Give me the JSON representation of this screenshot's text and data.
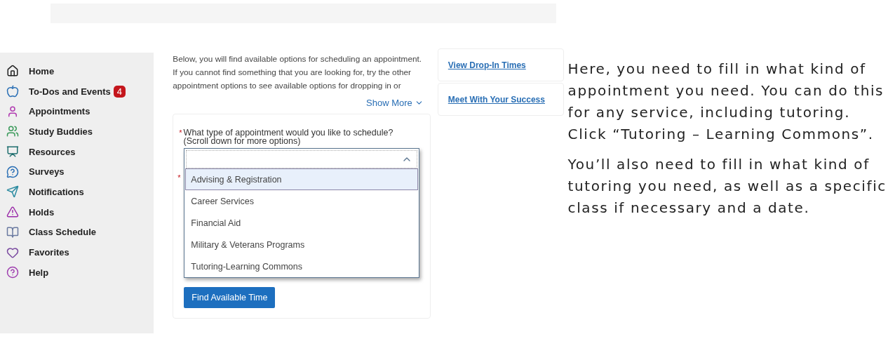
{
  "sidebar": {
    "items": [
      {
        "label": "Home",
        "color": "#222222"
      },
      {
        "label": "To-Dos and Events",
        "color": "#2a6fb5",
        "badge": "4"
      },
      {
        "label": "Appointments",
        "color": "#b03ab0"
      },
      {
        "label": "Study Buddies",
        "color": "#3a9a5a"
      },
      {
        "label": "Resources",
        "color": "#1e6e6e"
      },
      {
        "label": "Surveys",
        "color": "#2a6fb5"
      },
      {
        "label": "Notifications",
        "color": "#2a8aa0"
      },
      {
        "label": "Holds",
        "color": "#9a2aa8"
      },
      {
        "label": "Class Schedule",
        "color": "#6a7aa0"
      },
      {
        "label": "Favorites",
        "color": "#7a4aa0"
      },
      {
        "label": "Help",
        "color": "#a040b0"
      }
    ]
  },
  "intro": {
    "lines": [
      "Below, you will find available options for scheduling an appointment.",
      "If you cannot find something that you are looking for, try the other",
      "appointment options to see available options for dropping in or"
    ],
    "show_more": "Show More"
  },
  "form": {
    "required_mark": "*",
    "label": "What type of appointment would you like to schedule?",
    "hint": "(Scroll down for more options)",
    "dropdown": {
      "expanded": true,
      "options": [
        {
          "label": "Advising & Registration",
          "selected": true
        },
        {
          "label": "Career Services",
          "selected": false
        },
        {
          "label": "Financial Aid",
          "selected": false
        },
        {
          "label": "Military & Veterans Programs",
          "selected": false
        },
        {
          "label": "Tutoring-Learning Commons",
          "selected": false
        }
      ]
    },
    "second_required_mark": "*",
    "submit": "Find Available Time"
  },
  "links": [
    "View Drop-In Times",
    "Meet With Your Success"
  ],
  "explanation": [
    "Here, you need to fill in what kind of appointment you need. You can do this for any service, including tutoring. Click “Tutoring – Learning Commons”.",
    "You’ll also need to fill in what kind of tutoring you need, as well as a specific class if necessary and a date."
  ]
}
